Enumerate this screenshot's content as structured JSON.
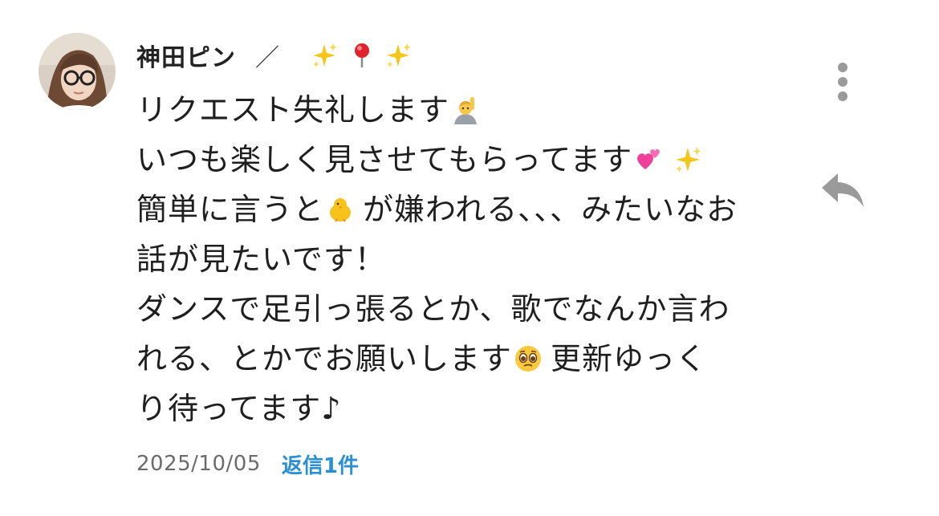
{
  "comment": {
    "author": "神田ピン",
    "author_separator": "／",
    "author_decoration_icons": [
      "sparkles-icon",
      "round-pushpin-icon",
      "sparkles-icon"
    ],
    "body_lines": [
      {
        "text": "リクエスト失礼します",
        "trailing_emoji": "person-raising-hand-icon"
      },
      {
        "text": "いつも楽しく見させてもらってます",
        "trailing_emoji": "two-hearts-icon"
      },
      {
        "prefix": "簡単に言うと",
        "inline_emoji": "hatching-chick-icon",
        "suffix": "が嫌われる、、、みたいなお"
      },
      {
        "text": "話が見たいです！"
      },
      {
        "text": "ダンスで足引っ張るとか、歌でなんか言わ"
      },
      {
        "prefix": "れる、とかでお願いします",
        "inline_emoji": "pleading-face-icon",
        "suffix": "更新ゆっく"
      },
      {
        "text": "り待ってます♪"
      }
    ],
    "date": "2025/10/05",
    "replies_label": "返信1件"
  },
  "colors": {
    "text": "#1f1f1f",
    "date": "#6b6b6b",
    "reply_link": "#2b8fd4",
    "icon_gray": "#9a9a9a"
  }
}
